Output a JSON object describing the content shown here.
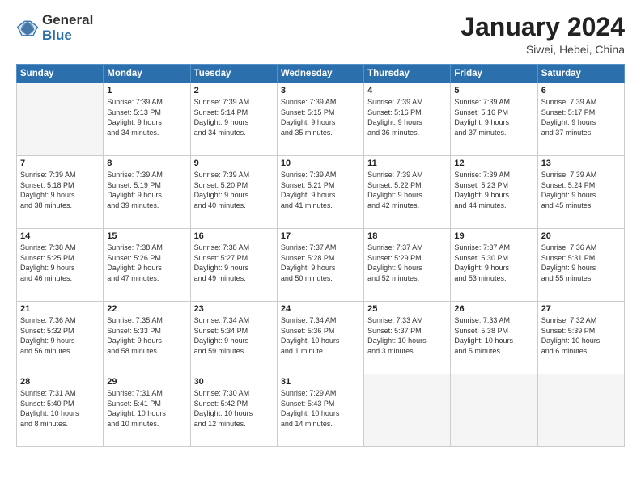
{
  "logo": {
    "general": "General",
    "blue": "Blue"
  },
  "header": {
    "month": "January 2024",
    "location": "Siwei, Hebei, China"
  },
  "weekdays": [
    "Sunday",
    "Monday",
    "Tuesday",
    "Wednesday",
    "Thursday",
    "Friday",
    "Saturday"
  ],
  "weeks": [
    [
      {
        "day": "",
        "info": ""
      },
      {
        "day": "1",
        "info": "Sunrise: 7:39 AM\nSunset: 5:13 PM\nDaylight: 9 hours\nand 34 minutes."
      },
      {
        "day": "2",
        "info": "Sunrise: 7:39 AM\nSunset: 5:14 PM\nDaylight: 9 hours\nand 34 minutes."
      },
      {
        "day": "3",
        "info": "Sunrise: 7:39 AM\nSunset: 5:15 PM\nDaylight: 9 hours\nand 35 minutes."
      },
      {
        "day": "4",
        "info": "Sunrise: 7:39 AM\nSunset: 5:16 PM\nDaylight: 9 hours\nand 36 minutes."
      },
      {
        "day": "5",
        "info": "Sunrise: 7:39 AM\nSunset: 5:16 PM\nDaylight: 9 hours\nand 37 minutes."
      },
      {
        "day": "6",
        "info": "Sunrise: 7:39 AM\nSunset: 5:17 PM\nDaylight: 9 hours\nand 37 minutes."
      }
    ],
    [
      {
        "day": "7",
        "info": "Sunrise: 7:39 AM\nSunset: 5:18 PM\nDaylight: 9 hours\nand 38 minutes."
      },
      {
        "day": "8",
        "info": "Sunrise: 7:39 AM\nSunset: 5:19 PM\nDaylight: 9 hours\nand 39 minutes."
      },
      {
        "day": "9",
        "info": "Sunrise: 7:39 AM\nSunset: 5:20 PM\nDaylight: 9 hours\nand 40 minutes."
      },
      {
        "day": "10",
        "info": "Sunrise: 7:39 AM\nSunset: 5:21 PM\nDaylight: 9 hours\nand 41 minutes."
      },
      {
        "day": "11",
        "info": "Sunrise: 7:39 AM\nSunset: 5:22 PM\nDaylight: 9 hours\nand 42 minutes."
      },
      {
        "day": "12",
        "info": "Sunrise: 7:39 AM\nSunset: 5:23 PM\nDaylight: 9 hours\nand 44 minutes."
      },
      {
        "day": "13",
        "info": "Sunrise: 7:39 AM\nSunset: 5:24 PM\nDaylight: 9 hours\nand 45 minutes."
      }
    ],
    [
      {
        "day": "14",
        "info": "Sunrise: 7:38 AM\nSunset: 5:25 PM\nDaylight: 9 hours\nand 46 minutes."
      },
      {
        "day": "15",
        "info": "Sunrise: 7:38 AM\nSunset: 5:26 PM\nDaylight: 9 hours\nand 47 minutes."
      },
      {
        "day": "16",
        "info": "Sunrise: 7:38 AM\nSunset: 5:27 PM\nDaylight: 9 hours\nand 49 minutes."
      },
      {
        "day": "17",
        "info": "Sunrise: 7:37 AM\nSunset: 5:28 PM\nDaylight: 9 hours\nand 50 minutes."
      },
      {
        "day": "18",
        "info": "Sunrise: 7:37 AM\nSunset: 5:29 PM\nDaylight: 9 hours\nand 52 minutes."
      },
      {
        "day": "19",
        "info": "Sunrise: 7:37 AM\nSunset: 5:30 PM\nDaylight: 9 hours\nand 53 minutes."
      },
      {
        "day": "20",
        "info": "Sunrise: 7:36 AM\nSunset: 5:31 PM\nDaylight: 9 hours\nand 55 minutes."
      }
    ],
    [
      {
        "day": "21",
        "info": "Sunrise: 7:36 AM\nSunset: 5:32 PM\nDaylight: 9 hours\nand 56 minutes."
      },
      {
        "day": "22",
        "info": "Sunrise: 7:35 AM\nSunset: 5:33 PM\nDaylight: 9 hours\nand 58 minutes."
      },
      {
        "day": "23",
        "info": "Sunrise: 7:34 AM\nSunset: 5:34 PM\nDaylight: 9 hours\nand 59 minutes."
      },
      {
        "day": "24",
        "info": "Sunrise: 7:34 AM\nSunset: 5:36 PM\nDaylight: 10 hours\nand 1 minute."
      },
      {
        "day": "25",
        "info": "Sunrise: 7:33 AM\nSunset: 5:37 PM\nDaylight: 10 hours\nand 3 minutes."
      },
      {
        "day": "26",
        "info": "Sunrise: 7:33 AM\nSunset: 5:38 PM\nDaylight: 10 hours\nand 5 minutes."
      },
      {
        "day": "27",
        "info": "Sunrise: 7:32 AM\nSunset: 5:39 PM\nDaylight: 10 hours\nand 6 minutes."
      }
    ],
    [
      {
        "day": "28",
        "info": "Sunrise: 7:31 AM\nSunset: 5:40 PM\nDaylight: 10 hours\nand 8 minutes."
      },
      {
        "day": "29",
        "info": "Sunrise: 7:31 AM\nSunset: 5:41 PM\nDaylight: 10 hours\nand 10 minutes."
      },
      {
        "day": "30",
        "info": "Sunrise: 7:30 AM\nSunset: 5:42 PM\nDaylight: 10 hours\nand 12 minutes."
      },
      {
        "day": "31",
        "info": "Sunrise: 7:29 AM\nSunset: 5:43 PM\nDaylight: 10 hours\nand 14 minutes."
      },
      {
        "day": "",
        "info": ""
      },
      {
        "day": "",
        "info": ""
      },
      {
        "day": "",
        "info": ""
      }
    ]
  ]
}
